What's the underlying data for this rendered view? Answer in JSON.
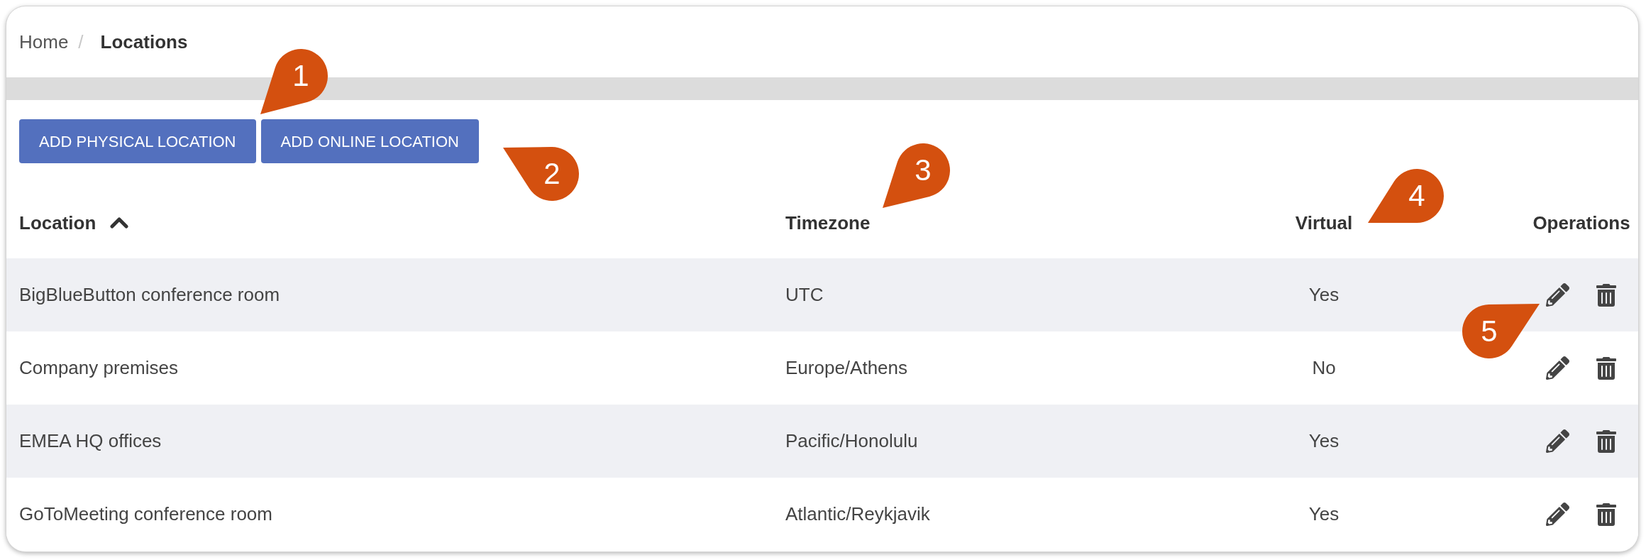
{
  "breadcrumb": {
    "items": [
      {
        "label": "Home",
        "current": false
      },
      {
        "label": "Locations",
        "current": true
      }
    ],
    "separator": "/"
  },
  "buttons": [
    {
      "label": "ADD PHYSICAL LOCATION"
    },
    {
      "label": "ADD ONLINE LOCATION"
    }
  ],
  "table": {
    "columns": [
      {
        "label": "Location",
        "sorted": true,
        "descending": false
      },
      {
        "label": "Timezone",
        "sorted": false
      },
      {
        "label": "Virtual",
        "sorted": false
      },
      {
        "label": "Operations",
        "sorted": false
      }
    ],
    "rows": [
      {
        "location": "BigBlueButton conference room",
        "timezone": "UTC",
        "virtual": "Yes"
      },
      {
        "location": "Company premises",
        "timezone": "Europe/Athens",
        "virtual": "No"
      },
      {
        "location": "EMEA HQ offices",
        "timezone": "Pacific/Honolulu",
        "virtual": "Yes"
      },
      {
        "location": "GoToMeeting conference room",
        "timezone": "Atlantic/Reykjavik",
        "virtual": "Yes"
      }
    ]
  },
  "callouts": [
    {
      "label": "1"
    },
    {
      "label": "2"
    },
    {
      "label": "3"
    },
    {
      "label": "4"
    },
    {
      "label": "5"
    }
  ]
}
